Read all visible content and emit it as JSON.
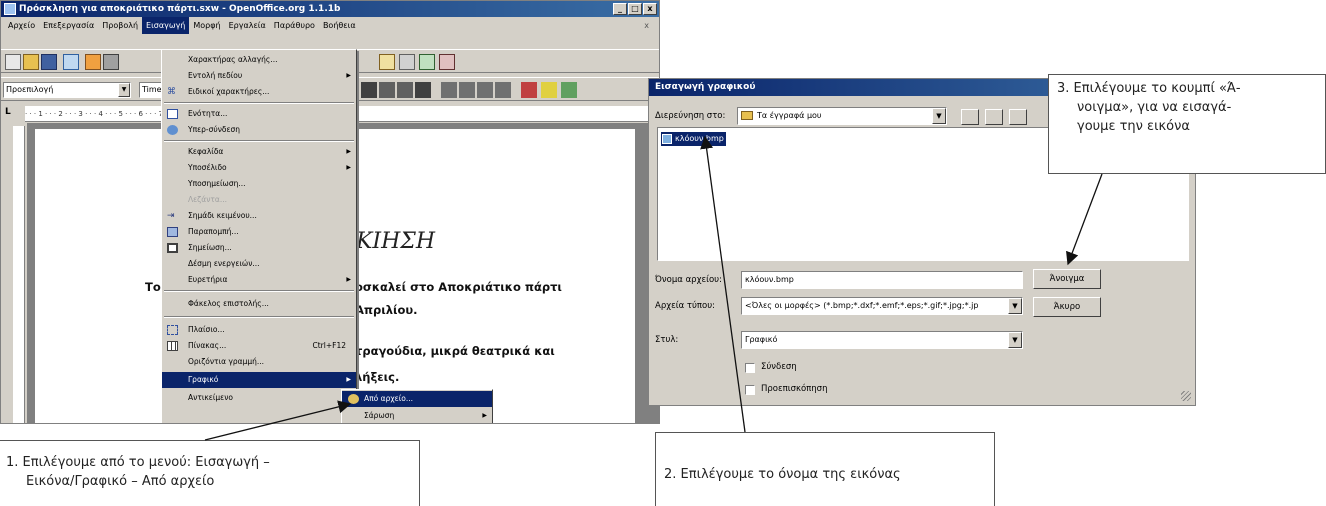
{
  "writer": {
    "title": "Πρόσκληση για αποκριάτικο πάρτι.sxw - OpenOffice.org 1.1.1b",
    "window_controls": [
      "_",
      "□",
      "x"
    ],
    "menubar": [
      "Αρχείο",
      "Επεξεργασία",
      "Προβολή",
      "Εισαγωγή",
      "Μορφή",
      "Εργαλεία",
      "Παράθυρο",
      "Βοήθεια"
    ],
    "menubar_close": "x",
    "style_box": "Προεπιλογή",
    "font_box": "Time",
    "combo_arrow": "▼",
    "ruler": "· · · 1 · · · 2 · · · 3 · · · 4 · · · 5 · · · 6 · · · 7 · · 8 · · 9 · · 10 · · 11 · · 12 · · 13 · · 14 · · 15",
    "document": {
      "heading": "ΚΙΗΣΗ",
      "line1_prefix": "Το",
      "line1": "οσκαλεί στο Αποκριάτικο πάρτι",
      "line2": "Απριλίου.",
      "line3": "τραγούδια, μικρά θεατρικά και",
      "line4": "λήξεις."
    },
    "insert_menu": [
      {
        "label": "Χαρακτήρας αλλαγής...",
        "icon": ""
      },
      {
        "label": "Εντολή πεδίου",
        "submenu": true
      },
      {
        "label": "Ειδικοί χαρακτήρες...",
        "icon": "special-char-icon"
      },
      {
        "separator": true
      },
      {
        "label": "Ενότητα...",
        "icon": "section-icon"
      },
      {
        "label": "Υπερ-σύνδεση",
        "icon": "hyperlink-icon"
      },
      {
        "separator": true
      },
      {
        "label": "Κεφαλίδα",
        "submenu": true
      },
      {
        "label": "Υποσέλιδο",
        "submenu": true
      },
      {
        "label": "Υποσημείωση...",
        "icon": ""
      },
      {
        "label": "Λεζάντα...",
        "disabled": true
      },
      {
        "label": "Σημάδι κειμένου...",
        "icon": "bookmark-icon"
      },
      {
        "label": "Παραπομπή...",
        "icon": "cross-ref-icon"
      },
      {
        "label": "Σημείωση...",
        "icon": "note-icon"
      },
      {
        "label": "Δέσμη ενεργειών...",
        "icon": ""
      },
      {
        "label": "Ευρετήρια",
        "submenu": true
      },
      {
        "separator": true
      },
      {
        "label": "Φάκελος επιστολής...",
        "icon": ""
      },
      {
        "separator": true
      },
      {
        "label": "Πλαίσιο...",
        "icon": "frame-icon"
      },
      {
        "label": "Πίνακας...",
        "shortcut": "Ctrl+F12",
        "icon": "table-icon"
      },
      {
        "label": "Οριζόντια γραμμή...",
        "icon": ""
      },
      {
        "label": "Γραφικό",
        "submenu": true,
        "selected": true
      },
      {
        "label": "Αντικείμενο",
        "submenu": true
      }
    ],
    "submenu_items": [
      "Από αρχείο...",
      "Σάρωση"
    ]
  },
  "dialog": {
    "title": "Εισαγωγή γραφικού",
    "lookin_label": "Διερεύνηση στο:",
    "lookin_value": "Τα έγγραφά μου",
    "file_item": "κλόουν.bmp",
    "filename_label": "Όνομα αρχείου:",
    "filename_value": "κλόουν.bmp",
    "filetype_label": "Αρχεία τύπου:",
    "filetype_value": "<Όλες οι μορφές> (*.bmp;*.dxf;*.emf;*.eps;*.gif;*.jpg;*.jp",
    "style_label": "Στυλ:",
    "style_value": "Γραφικό",
    "open_button": "Άνοιγμα",
    "cancel_button": "Άκυρο",
    "link_checkbox": "Σύνδεση",
    "preview_checkbox": "Προεπισκόπηση",
    "combo_arrow": "▼"
  },
  "callouts": {
    "step1_line1": "1. Επιλέγουμε από το μενού: Εισαγωγή –",
    "step1_line2": "Εικόνα/Γραφικό – Από αρχείο",
    "step2": "2. Επιλέγουμε το όνομα της εικόνας",
    "step3_line1": "3. Επιλέγουμε το κουμπί «Ά-",
    "step3_line2": "νοιγμα», για να εισαγά-",
    "step3_line3": "γουμε την εικόνα"
  }
}
